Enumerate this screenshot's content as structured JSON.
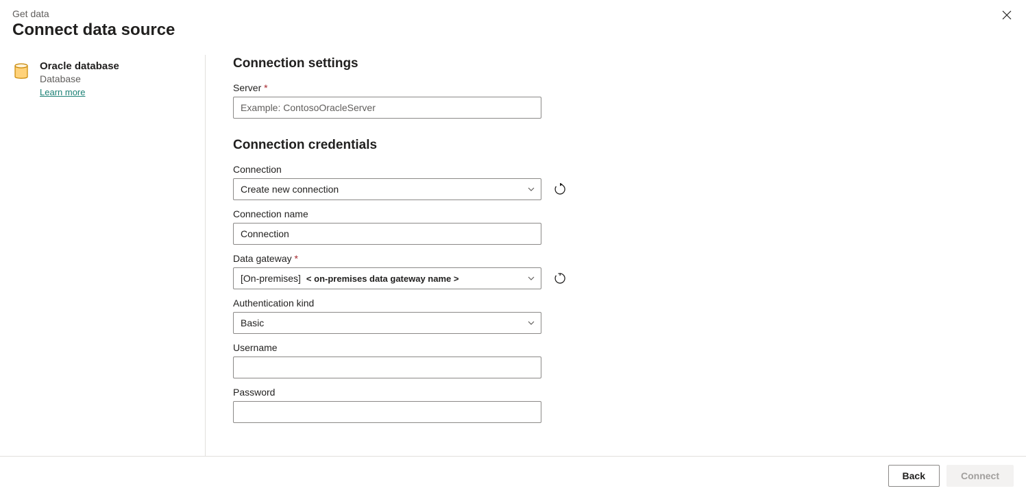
{
  "header": {
    "breadcrumb": "Get data",
    "title": "Connect data source"
  },
  "sidebar": {
    "source": {
      "name": "Oracle database",
      "category": "Database",
      "learn_more": "Learn more"
    }
  },
  "settings": {
    "title": "Connection settings",
    "server_label": "Server",
    "server_placeholder": "Example: ContosoOracleServer"
  },
  "credentials": {
    "title": "Connection credentials",
    "connection_label": "Connection",
    "connection_value": "Create new connection",
    "connection_name_label": "Connection name",
    "connection_name_value": "Connection",
    "gateway_label": "Data gateway",
    "gateway_value_prefix": "[On-premises]",
    "gateway_value_sub": "< on-premises data gateway name >",
    "auth_label": "Authentication kind",
    "auth_value": "Basic",
    "username_label": "Username",
    "password_label": "Password"
  },
  "footer": {
    "back": "Back",
    "connect": "Connect"
  }
}
